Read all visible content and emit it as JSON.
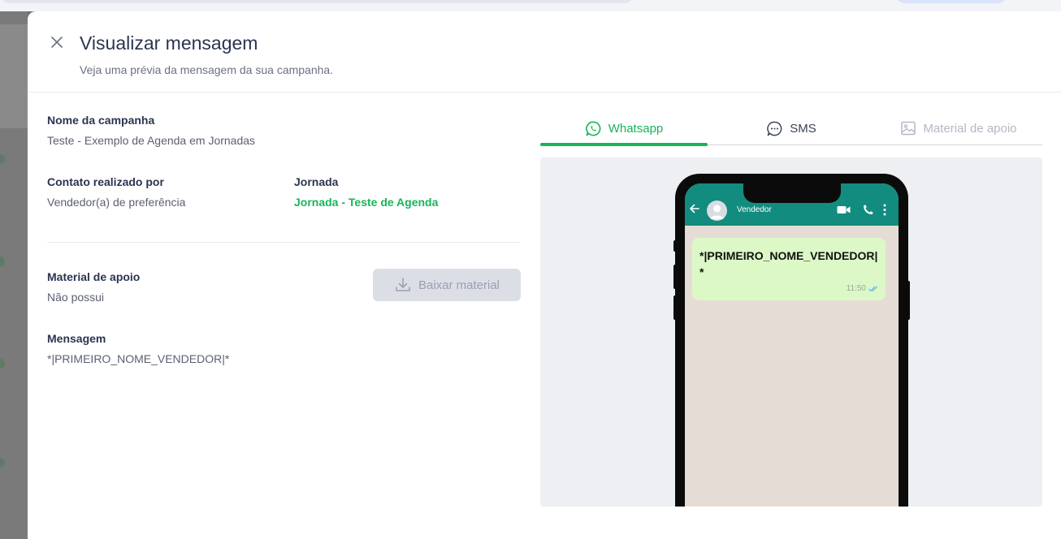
{
  "header": {
    "title": "Visualizar mensagem",
    "subtitle": "Veja uma prévia da mensagem da sua campanha."
  },
  "details": {
    "campaign_name_label": "Nome da campanha",
    "campaign_name_value": "Teste - Exemplo de Agenda em Jornadas",
    "contact_label": "Contato realizado por",
    "contact_value": "Vendedor(a) de preferência",
    "journey_label": "Jornada",
    "journey_value": "Jornada - Teste de Agenda",
    "material_label": "Material de apoio",
    "material_value": "Não possui",
    "download_button": "Baixar material",
    "message_label": "Mensagem",
    "message_value": "*|PRIMEIRO_NOME_VENDEDOR|*"
  },
  "tabs": [
    {
      "label": "Whatsapp",
      "state": "active"
    },
    {
      "label": "SMS",
      "state": "normal"
    },
    {
      "label": "Material de apoio",
      "state": "disabled"
    }
  ],
  "preview": {
    "contact_name": "Vendedor",
    "message_text": "*|PRIMEIRO_NOME_VENDEDOR|*",
    "message_time": "11:50"
  },
  "colors": {
    "accent": "#19b45a",
    "title": "#2b3550",
    "whatsapp_bar": "#128c7e",
    "bubble": "#dcf8c6",
    "chat_bg": "#e5ddd5"
  },
  "icons": {
    "close": "close-icon",
    "download": "download-icon",
    "whatsapp": "whatsapp-icon",
    "sms": "chat-bubble-icon",
    "material": "image-icon"
  }
}
